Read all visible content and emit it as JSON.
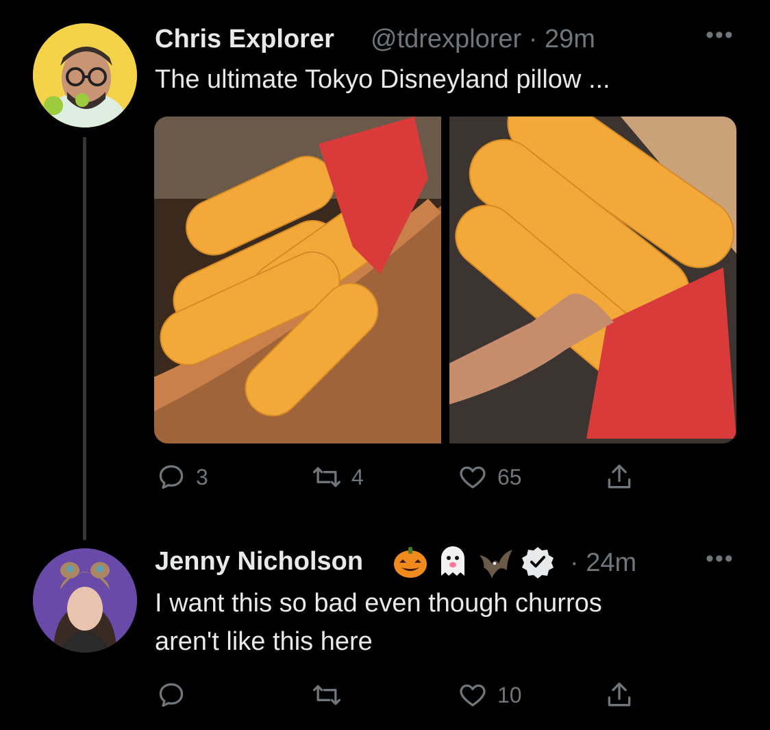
{
  "tweet1": {
    "name": "Chris Explorer",
    "handle": "@tdrexplorer",
    "sep": " · ",
    "time": "29m",
    "more": "•••",
    "text": "The ultimate Tokyo Disneyland pillow ...",
    "replies": "3",
    "retweets": "4",
    "likes": "65"
  },
  "tweet2": {
    "name": "Jenny Nicholson",
    "sep": " · ",
    "time": "24m",
    "more": "•••",
    "text_line1": "I want this so bad even though churros",
    "text_line2": "aren't like this here",
    "replies": "",
    "retweets": "",
    "likes": "10"
  },
  "colors": {
    "bg": "#000000",
    "text": "#e7e9ea",
    "muted": "#71767b",
    "verified": "#e7e9ea"
  },
  "icons": [
    "reply-icon",
    "retweet-icon",
    "like-icon",
    "share-icon",
    "verified-icon"
  ]
}
